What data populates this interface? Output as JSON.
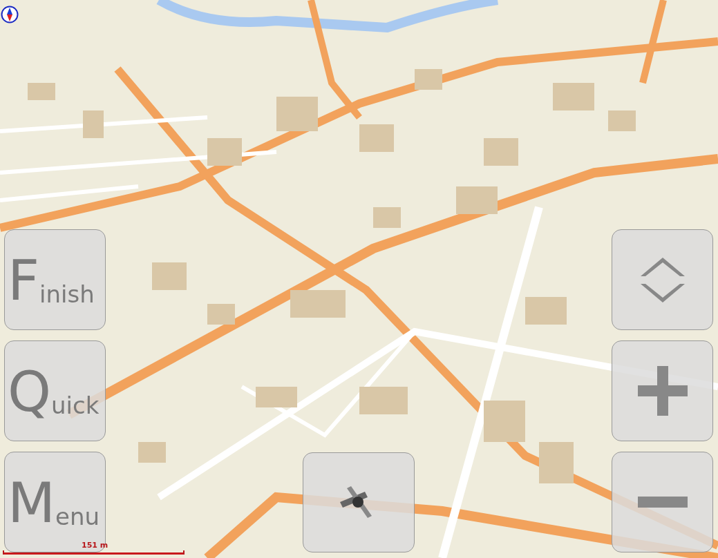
{
  "left_buttons": [
    {
      "label": "Finish"
    },
    {
      "label": "Quick"
    },
    {
      "label": "Menu"
    }
  ],
  "right_buttons": [
    {
      "kind": "updown"
    },
    {
      "kind": "plus"
    },
    {
      "kind": "minus"
    }
  ],
  "scale_bar": {
    "label": "151 m"
  }
}
